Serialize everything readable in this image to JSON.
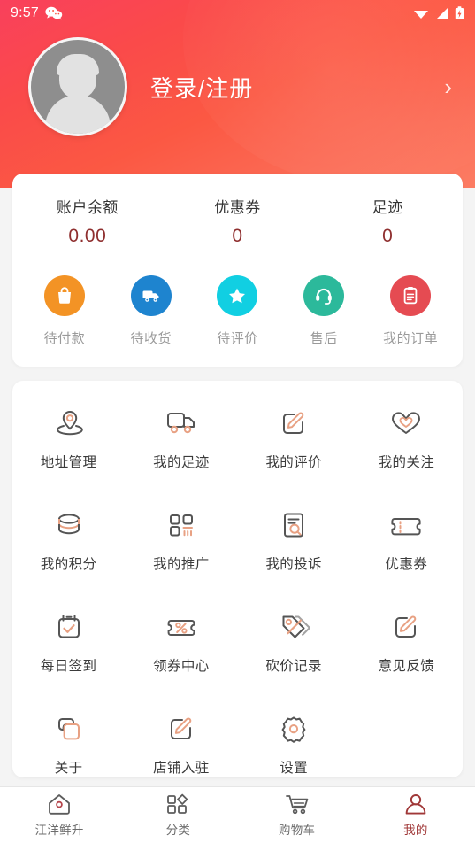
{
  "status_bar": {
    "time": "9:57",
    "icons": [
      "wechat-icon",
      "wifi-icon",
      "signal-icon",
      "battery-charging-icon"
    ]
  },
  "header": {
    "avatar": "default-user-avatar",
    "login_label": "登录/注册",
    "chevron": "›",
    "gradient_from": "#f9405c",
    "gradient_to": "#fc7c63"
  },
  "account_card": {
    "stats": [
      {
        "label": "账户余额",
        "value": "0.00"
      },
      {
        "label": "优惠券",
        "value": "0"
      },
      {
        "label": "足迹",
        "value": "0"
      }
    ],
    "value_color": "#8f2f2f",
    "orders": [
      {
        "label": "待付款",
        "icon": "shopping-bag-icon",
        "color": "#f39325"
      },
      {
        "label": "待收货",
        "icon": "delivery-truck-icon",
        "color": "#1e84cf"
      },
      {
        "label": "待评价",
        "icon": "star-icon",
        "color": "#11cfe2"
      },
      {
        "label": "售后",
        "icon": "headset-icon",
        "color": "#2cb99b"
      },
      {
        "label": "我的订单",
        "icon": "clipboard-icon",
        "color": "#e54b52"
      }
    ]
  },
  "menu_card": {
    "items": [
      {
        "label": "地址管理",
        "icon": "location-pin-icon"
      },
      {
        "label": "我的足迹",
        "icon": "truck-icon"
      },
      {
        "label": "我的评价",
        "icon": "edit-square-icon"
      },
      {
        "label": "我的关注",
        "icon": "heart-icon"
      },
      {
        "label": "我的积分",
        "icon": "coins-icon"
      },
      {
        "label": "我的推广",
        "icon": "grid-promo-icon"
      },
      {
        "label": "我的投诉",
        "icon": "document-search-icon"
      },
      {
        "label": "优惠券",
        "icon": "coupon-ticket-icon"
      },
      {
        "label": "每日签到",
        "icon": "calendar-check-icon"
      },
      {
        "label": "领券中心",
        "icon": "percent-ticket-icon"
      },
      {
        "label": "砍价记录",
        "icon": "price-tag-icon"
      },
      {
        "label": "意见反馈",
        "icon": "edit-square-icon"
      },
      {
        "label": "关于",
        "icon": "overlapping-squares-icon"
      },
      {
        "label": "店铺入驻",
        "icon": "edit-square-icon"
      },
      {
        "label": "设置",
        "icon": "gear-icon"
      }
    ],
    "icon_outline_color": "#555555",
    "icon_accent_color": "#e8a183"
  },
  "tabbar": {
    "active_color": "#a03838",
    "inactive_color": "#6d6d6d",
    "tabs": [
      {
        "label": "江洋鲜升",
        "icon": "home-icon",
        "active": false
      },
      {
        "label": "分类",
        "icon": "category-icon",
        "active": false
      },
      {
        "label": "购物车",
        "icon": "cart-icon",
        "active": false
      },
      {
        "label": "我的",
        "icon": "user-icon",
        "active": true
      }
    ]
  }
}
